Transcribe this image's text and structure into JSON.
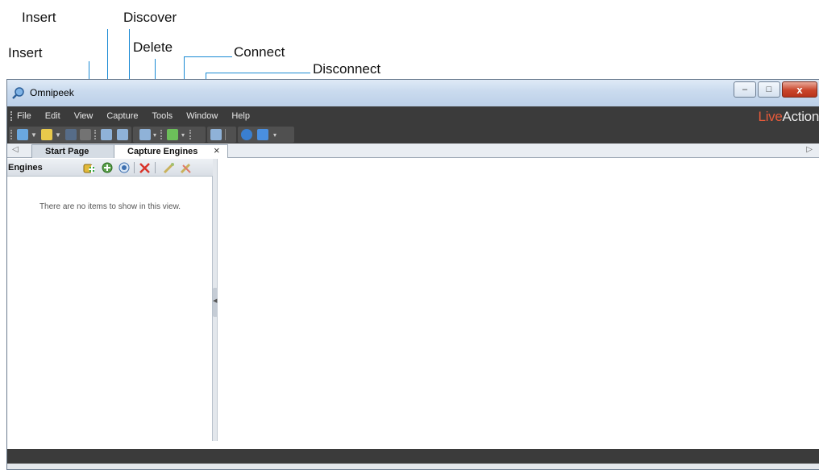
{
  "callouts": [
    {
      "id": "insert-1",
      "label": "Insert"
    },
    {
      "id": "discover",
      "label": "Discover"
    },
    {
      "id": "insert-2",
      "label": "Insert"
    },
    {
      "id": "delete",
      "label": "Delete"
    },
    {
      "id": "connect",
      "label": "Connect"
    },
    {
      "id": "disconnect",
      "label": "Disconnect"
    }
  ],
  "window": {
    "title": "Omnipeek",
    "controls": {
      "minimize": "–",
      "maximize": "□",
      "close": "x"
    }
  },
  "menu": {
    "items": [
      "File",
      "Edit",
      "View",
      "Capture",
      "Tools",
      "Window",
      "Help"
    ]
  },
  "brand": {
    "part1": "Live",
    "part2": "Action",
    "color": "#e55a3a"
  },
  "tabs": {
    "scroll_left": "◁",
    "scroll_right": "▷",
    "items": [
      {
        "label": "Start Page",
        "active": false
      },
      {
        "label": "Capture Engines",
        "active": true
      }
    ],
    "close_glyph": "×"
  },
  "engines_panel": {
    "title": "Engines",
    "empty_message": "There are no items to show in this view.",
    "toolbar_icons": [
      "insert-engine-icon",
      "insert-engine-group-icon",
      "discover-icon",
      "delete-icon",
      "connect-icon",
      "disconnect-icon"
    ]
  },
  "toolbar": {
    "icons": [
      "new-capture-icon",
      "open-icon",
      "save-icon",
      "print-icon",
      "capture-options-icon",
      "filters-icon",
      "notes-icon",
      "forensic-icon",
      "packet-list-icon",
      "help-icon",
      "about-icon"
    ]
  },
  "colors": {
    "dark_bar": "#3b3b3b",
    "callout_line": "#1a8ad4",
    "title_gradient_top": "#dfeaf6"
  }
}
